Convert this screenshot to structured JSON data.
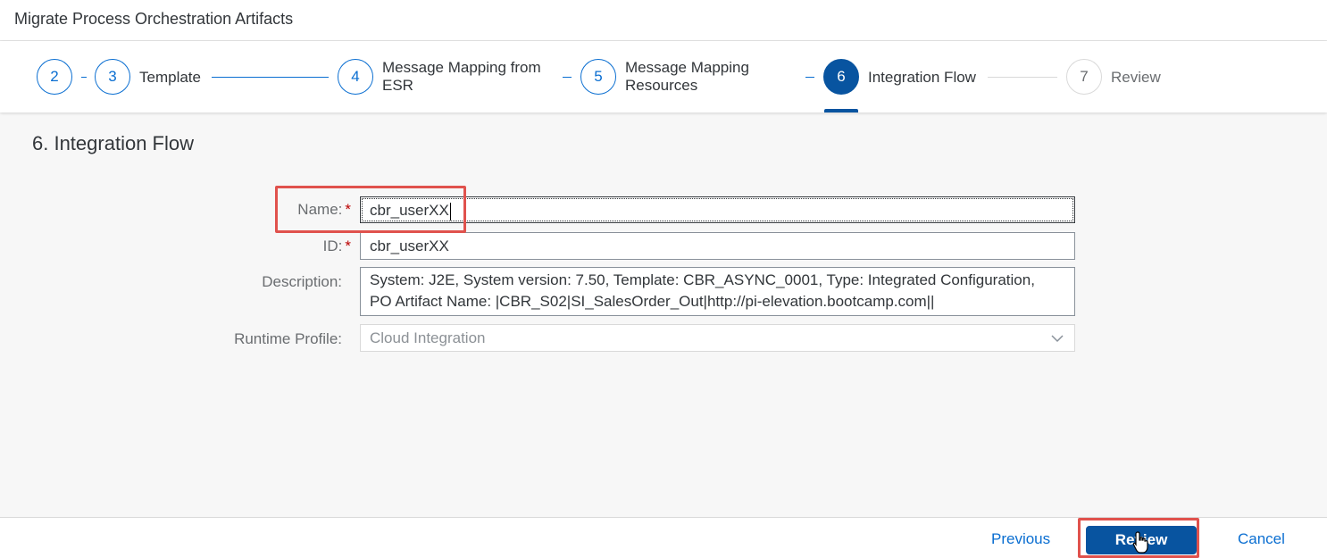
{
  "dialog": {
    "title": "Migrate Process Orchestration Artifacts"
  },
  "wizard": {
    "steps": [
      {
        "number": "2",
        "label": ""
      },
      {
        "number": "3",
        "label": "Template"
      },
      {
        "number": "4",
        "label_line1": "Message Mapping from",
        "label_line2": "ESR"
      },
      {
        "number": "5",
        "label_line1": "Message Mapping",
        "label_line2": "Resources"
      },
      {
        "number": "6",
        "label": "Integration Flow"
      },
      {
        "number": "7",
        "label": "Review"
      }
    ]
  },
  "section": {
    "title": "6. Integration Flow"
  },
  "form": {
    "name": {
      "label": "Name:",
      "required": "*",
      "value": "cbr_userXX"
    },
    "id": {
      "label": "ID:",
      "required": "*",
      "value": "cbr_userXX"
    },
    "description": {
      "label": "Description:",
      "line1": "System: J2E, System version: 7.50, Template: CBR_ASYNC_0001, Type: Integrated Configuration,",
      "line2": "PO Artifact Name: |CBR_S02|SI_SalesOrder_Out|http://pi-elevation.bootcamp.com||"
    },
    "runtime_profile": {
      "label": "Runtime Profile:",
      "value": "Cloud Integration"
    }
  },
  "footer": {
    "previous_label": "Previous",
    "review_label": "Review",
    "cancel_label": "Cancel"
  },
  "colors": {
    "accent": "#0a6ed1",
    "primary_button": "#0854a0",
    "highlight": "#e0524d",
    "required": "#bb0000"
  },
  "icons": {
    "dropdown": "chevron-down-icon",
    "cursor": "hand-pointer-icon"
  }
}
